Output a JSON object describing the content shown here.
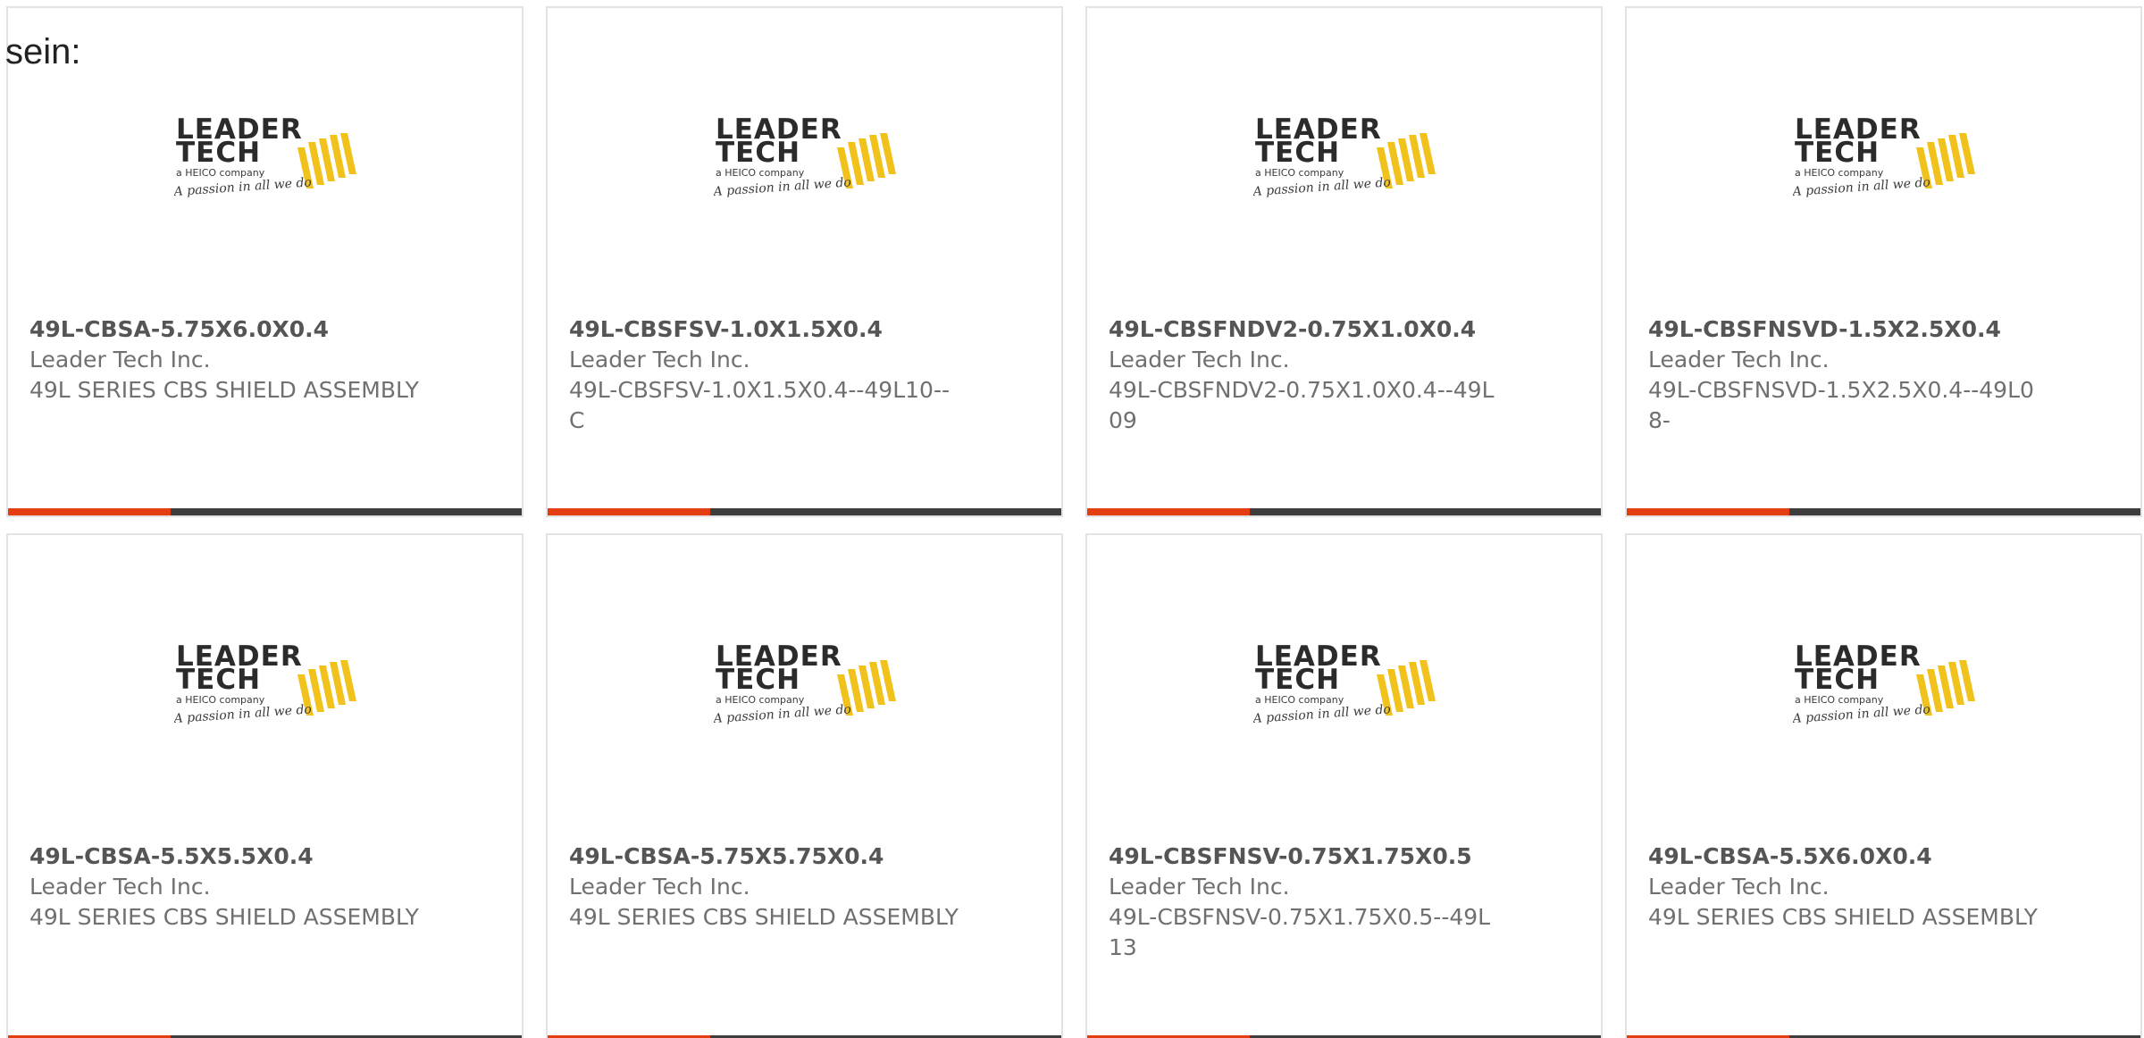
{
  "lead_text": "sein:",
  "logo": {
    "line1": "LEADER",
    "line2": "TECH",
    "line3": "a HEICO company",
    "tagline": "A passion in all we do",
    "colors": {
      "text": "#2b2b2b",
      "stripes": "#f0c21b"
    }
  },
  "colors": {
    "accent": "#e43d12",
    "bar": "#3d3d3d"
  },
  "products": [
    {
      "part": "49L-CBSA-5.75X6.0X0.4",
      "manufacturer": "Leader Tech Inc.",
      "description": "49L SERIES CBS SHIELD ASSEMBLY"
    },
    {
      "part": "49L-CBSFSV-1.0X1.5X0.4",
      "manufacturer": "Leader Tech Inc.",
      "description": "49L-CBSFSV-1.0X1.5X0.4--49L10--C"
    },
    {
      "part": "49L-CBSFNDV2-0.75X1.0X0.4",
      "manufacturer": "Leader Tech Inc.",
      "description": "49L-CBSFNDV2-0.75X1.0X0.4--49L09"
    },
    {
      "part": "49L-CBSFNSVD-1.5X2.5X0.4",
      "manufacturer": "Leader Tech Inc.",
      "description": "49L-CBSFNSVD-1.5X2.5X0.4--49L08-"
    },
    {
      "part": "49L-CBSA-5.5X5.5X0.4",
      "manufacturer": "Leader Tech Inc.",
      "description": "49L SERIES CBS SHIELD ASSEMBLY"
    },
    {
      "part": "49L-CBSA-5.75X5.75X0.4",
      "manufacturer": "Leader Tech Inc.",
      "description": "49L SERIES CBS SHIELD ASSEMBLY"
    },
    {
      "part": "49L-CBSFNSV-0.75X1.75X0.5",
      "manufacturer": "Leader Tech Inc.",
      "description": "49L-CBSFNSV-0.75X1.75X0.5--49L13"
    },
    {
      "part": "49L-CBSA-5.5X6.0X0.4",
      "manufacturer": "Leader Tech Inc.",
      "description": "49L SERIES CBS SHIELD ASSEMBLY"
    }
  ]
}
